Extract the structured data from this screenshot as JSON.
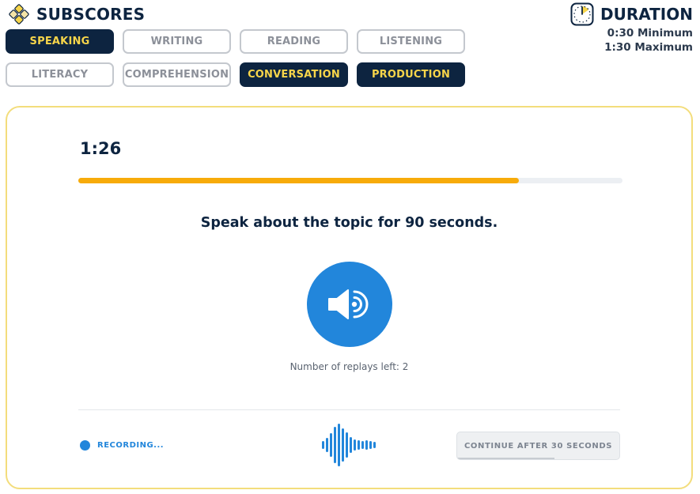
{
  "header": {
    "logo_icon": "subscores-diamond-logo-icon",
    "title": "SUBSCORES"
  },
  "subscores": [
    {
      "label": "SPEAKING",
      "active": true
    },
    {
      "label": "WRITING",
      "active": false
    },
    {
      "label": "READING",
      "active": false
    },
    {
      "label": "LISTENING",
      "active": false
    },
    {
      "label": "LITERACY",
      "active": false
    },
    {
      "label": "COMPREHENSION",
      "active": false
    },
    {
      "label": "CONVERSATION",
      "active": true
    },
    {
      "label": "PRODUCTION",
      "active": true
    }
  ],
  "duration": {
    "icon": "clock-icon",
    "title": "DURATION",
    "minimum": "0:30 Minimum",
    "maximum": "1:30 Maximum"
  },
  "task": {
    "timer": "1:26",
    "progress_fraction": 0.81,
    "prompt": "Speak about the topic for 90 seconds.",
    "play_icon": "speaker-audio-icon",
    "replays_text": "Number of replays left: 2"
  },
  "footer": {
    "recording_text": "RECORDING...",
    "waveform_icon": "audio-waveform-icon",
    "continue_label": "CONTINUE AFTER 30 SECONDS",
    "continue_enabled": false
  },
  "colors": {
    "navy": "#0d2440",
    "active_chip_text": "#f7d54a",
    "accent_blue": "#2286db",
    "progress_orange": "#f7ab0a",
    "card_border": "#f3dd7c"
  }
}
